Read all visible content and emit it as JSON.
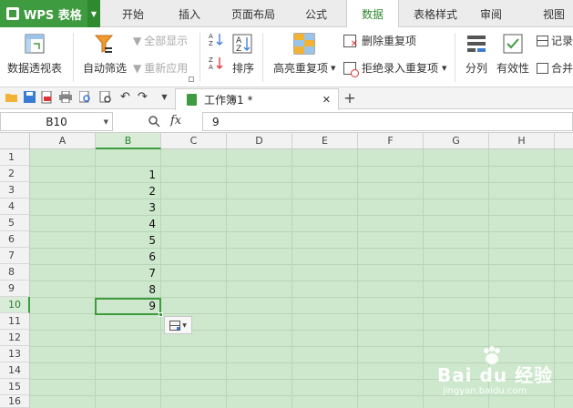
{
  "app": {
    "logo": "WPS 表格"
  },
  "menu_tabs": [
    "开始",
    "插入",
    "页面布局",
    "公式",
    "数据",
    "表格样式",
    "审阅",
    "视图"
  ],
  "active_tab": "数据",
  "ribbon": {
    "pivot": "数据透视表",
    "autofilter": "自动筛选",
    "show_all": "全部显示",
    "reapply": "重新应用",
    "sort": "排序",
    "highlight_dup": "高亮重复项",
    "remove_dup": "删除重复项",
    "reject_dup": "拒绝录入重复项",
    "split": "分列",
    "validity": "有效性",
    "record": "记录",
    "merge": "合并"
  },
  "doc_tab": {
    "name": "工作簿1 *"
  },
  "formula_bar": {
    "cell_ref": "B10",
    "fx": "fx",
    "value": "9"
  },
  "columns": [
    "A",
    "B",
    "C",
    "D",
    "E",
    "F",
    "G",
    "H"
  ],
  "selected_column": "B",
  "rows": [
    "1",
    "2",
    "3",
    "4",
    "5",
    "6",
    "7",
    "8",
    "9",
    "10",
    "11",
    "12",
    "13",
    "14",
    "15",
    "16"
  ],
  "selected_row": "10",
  "cells_B": {
    "r2": "1",
    "r3": "2",
    "r4": "3",
    "r5": "4",
    "r6": "5",
    "r7": "6",
    "r8": "7",
    "r9": "8",
    "r10": "9"
  },
  "watermark": {
    "brand": "Bai du 经验",
    "url": "jingyan.baidu.com"
  },
  "colors": {
    "accent": "#3f9b3f",
    "grid_bg": "#cde8cd"
  }
}
